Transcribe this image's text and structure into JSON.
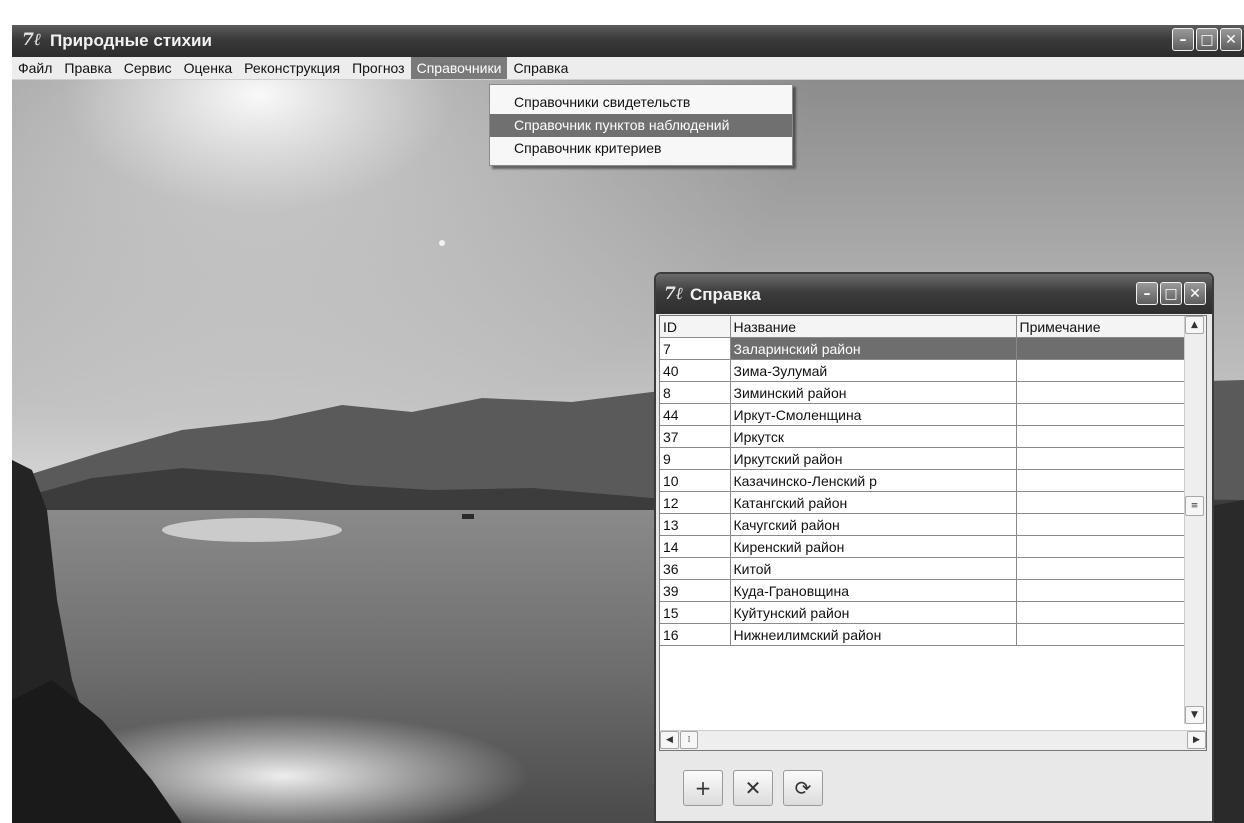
{
  "app": {
    "title": "Природные стихии",
    "logo_glyph": "7ℓ",
    "window_buttons": {
      "minimize": "–",
      "maximize": "□",
      "close": "✕"
    }
  },
  "menu": {
    "items": [
      {
        "label": "Файл"
      },
      {
        "label": "Правка"
      },
      {
        "label": "Сервис"
      },
      {
        "label": "Оценка"
      },
      {
        "label": "Реконструкция"
      },
      {
        "label": "Прогноз"
      },
      {
        "label": "Справочники",
        "active": true
      },
      {
        "label": "Справка"
      }
    ],
    "dropdown": [
      {
        "label": "Справочники свидетельств"
      },
      {
        "label": "Справочник пунктов наблюдений",
        "highlighted": true
      },
      {
        "label": "Справочник критериев"
      }
    ]
  },
  "child_window": {
    "title": "Справка",
    "logo_glyph": "7ℓ",
    "columns": {
      "id": "ID",
      "name": "Название",
      "note": "Примечание"
    },
    "rows": [
      {
        "id": "7",
        "name": "Заларинский район",
        "selected": true
      },
      {
        "id": "40",
        "name": "Зима-Зулумай"
      },
      {
        "id": "8",
        "name": "Зиминский район"
      },
      {
        "id": "44",
        "name": "Иркут-Смоленщина"
      },
      {
        "id": "37",
        "name": "Иркутск"
      },
      {
        "id": "9",
        "name": "Иркутский район"
      },
      {
        "id": "10",
        "name": "Казачинско-Ленский р"
      },
      {
        "id": "12",
        "name": "Катангский район"
      },
      {
        "id": "13",
        "name": "Качугский район"
      },
      {
        "id": "14",
        "name": "Киренский район"
      },
      {
        "id": "36",
        "name": "Китой"
      },
      {
        "id": "39",
        "name": "Куда-Грановщина"
      },
      {
        "id": "15",
        "name": "Куйтунский район"
      },
      {
        "id": "16",
        "name": "Нижнеилимский район"
      }
    ],
    "toolbar": {
      "add": "+",
      "delete": "✕",
      "refresh": "⟳"
    }
  },
  "colors": {
    "titlebar": "#3a3a3a",
    "selection": "#6e6e6e",
    "menu_bg": "#ededed"
  }
}
